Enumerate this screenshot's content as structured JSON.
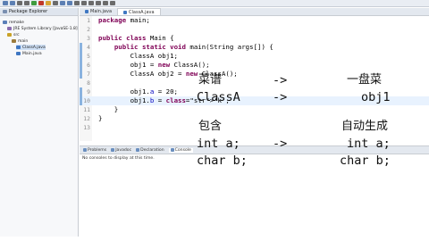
{
  "toolbar": {
    "buttons": [
      "#5c7fb3",
      "#5c7fb3",
      "#6b6b6b",
      "#6b6b6b",
      "#3f9b3f",
      "#c0392b",
      "#d8a534",
      "#6b6b6b",
      "#5c7fb3",
      "#5c7fb3",
      "#6b6b6b",
      "#6b6b6b",
      "#6b6b6b",
      "#6b6b6b",
      "#6b6b6b",
      "#6b6b6b"
    ]
  },
  "package_explorer": {
    "title": "Package Explorer",
    "tree": [
      {
        "label": "remake",
        "indent": 0,
        "icon_color": "#5a7fb8"
      },
      {
        "label": "JRE System Library [JavaSE-1.8]",
        "indent": 1,
        "icon_color": "#8a6cb0"
      },
      {
        "label": "src",
        "indent": 1,
        "icon_color": "#c9a227"
      },
      {
        "label": "main",
        "indent": 2,
        "icon_color": "#9b7b3b"
      },
      {
        "label": "ClassA.java",
        "indent": 3,
        "icon_color": "#3f77c2",
        "selected": true
      },
      {
        "label": "Main.java",
        "indent": 3,
        "icon_color": "#3f77c2"
      }
    ]
  },
  "editor_tabs": [
    {
      "label": "Main.java",
      "active": false
    },
    {
      "label": "ClassA.java",
      "active": true
    }
  ],
  "code_lines": [
    {
      "num": "1",
      "text": "package main;"
    },
    {
      "num": "2",
      "text": ""
    },
    {
      "num": "3",
      "text": "public class Main {"
    },
    {
      "num": "4",
      "text": "    public static void main(String args[]) {"
    },
    {
      "num": "5",
      "text": "        ClassA obj1;"
    },
    {
      "num": "6",
      "text": "        obj1 = new ClassA();"
    },
    {
      "num": "7",
      "text": "        ClassA obj2 = new ClassA();"
    },
    {
      "num": "8",
      "text": ""
    },
    {
      "num": "9",
      "text": "        obj1.a = 20;"
    },
    {
      "num": "10",
      "text": "        obj1.b = 'k';"
    },
    {
      "num": "11",
      "text": "    }"
    },
    {
      "num": "12",
      "text": "}"
    },
    {
      "num": "13",
      "text": ""
    }
  ],
  "bottom_panel": {
    "tabs": [
      "Problems",
      "Javadoc",
      "Declaration",
      "Console"
    ],
    "active_tab": "Console",
    "message": "No consoles to display at this time."
  },
  "overlay": {
    "row1": {
      "left": "菜谱",
      "arrow": "->",
      "right": "一盘菜"
    },
    "row2": {
      "left": "ClassA",
      "arrow": "->",
      "right": "obj1"
    },
    "row3": {
      "left": "包含",
      "right": "自动生成"
    },
    "row4": {
      "left": "int a;",
      "arrow": "->",
      "right": "int a;"
    },
    "row5": {
      "left": "char b;",
      "right": "char b;"
    }
  }
}
